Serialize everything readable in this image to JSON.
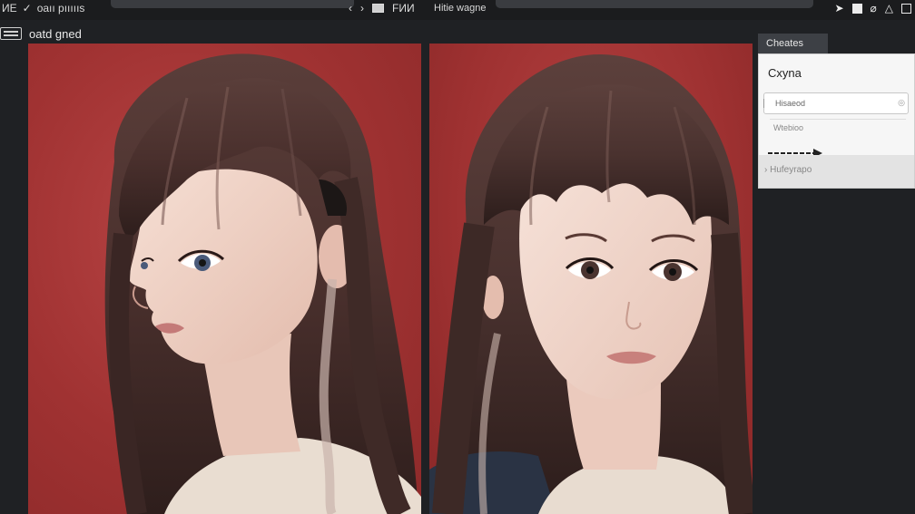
{
  "topbar": {
    "left_icon_label": "ИE",
    "tool_label": "oaıı pıııııs",
    "nav_back": "‹",
    "nav_forward": "›",
    "mid_label": "FИИ",
    "right_label": "Hitie wagne",
    "icons": [
      "cursor-icon",
      "square-icon",
      "eyedropper-icon",
      "warning-icon",
      "frame-icon"
    ]
  },
  "subheader": {
    "title": "oatd gned"
  },
  "canvas": {
    "background_color": "#a23535",
    "panels": [
      "portrait-side-profile",
      "portrait-front"
    ]
  },
  "dropdown_panel": {
    "tab_label": "Cheates",
    "title": "Cxyna",
    "field_value": "Hisaeod",
    "sub_label": "Wtebioo",
    "footer_label": "Hufeyrapo"
  }
}
